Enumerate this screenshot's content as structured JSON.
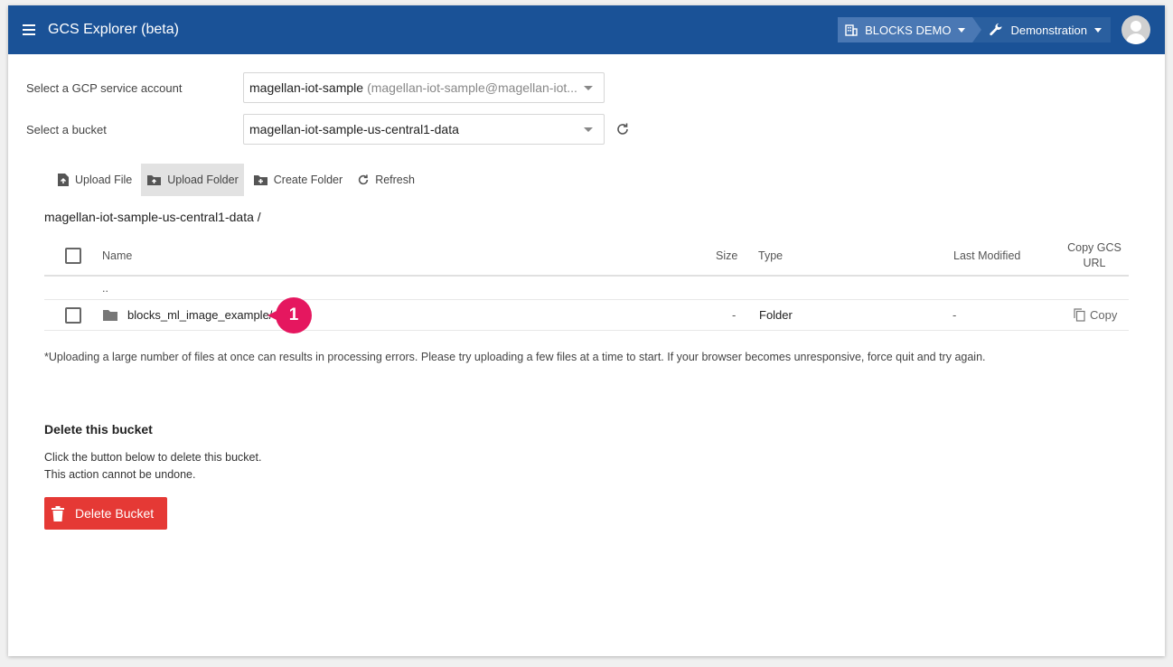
{
  "app": {
    "title": "GCS Explorer (beta)",
    "org_label": "BLOCKS DEMO",
    "project_label": "Demonstration"
  },
  "form": {
    "account_label": "Select a GCP service account",
    "account_value": "magellan-iot-sample",
    "account_detail": "(magellan-iot-sample@magellan-iot...",
    "bucket_label": "Select a bucket",
    "bucket_value": "magellan-iot-sample-us-central1-data"
  },
  "toolbar": {
    "upload_file": "Upload File",
    "upload_folder": "Upload Folder",
    "create_folder": "Create Folder",
    "refresh": "Refresh"
  },
  "path": "magellan-iot-sample-us-central1-data  /",
  "table": {
    "headers": {
      "name": "Name",
      "size": "Size",
      "type": "Type",
      "modified": "Last Modified",
      "copy": "Copy GCS URL"
    },
    "parent": "..",
    "rows": [
      {
        "name": "blocks_ml_image_example/",
        "size": "-",
        "type": "Folder",
        "modified": "-",
        "copy": "Copy"
      }
    ]
  },
  "annotation": "1",
  "note": "*Uploading a large number of files at once can results in processing errors. Please try uploading a few files at a time to start. If your browser becomes unresponsive, force quit and try again.",
  "delete": {
    "title": "Delete this bucket",
    "line1": "Click the button below to delete this bucket.",
    "line2": "This action cannot be undone.",
    "button": "Delete Bucket"
  },
  "colors": {
    "appbar": "#1a5297",
    "danger": "#e53935",
    "annotation": "#e5175f"
  }
}
